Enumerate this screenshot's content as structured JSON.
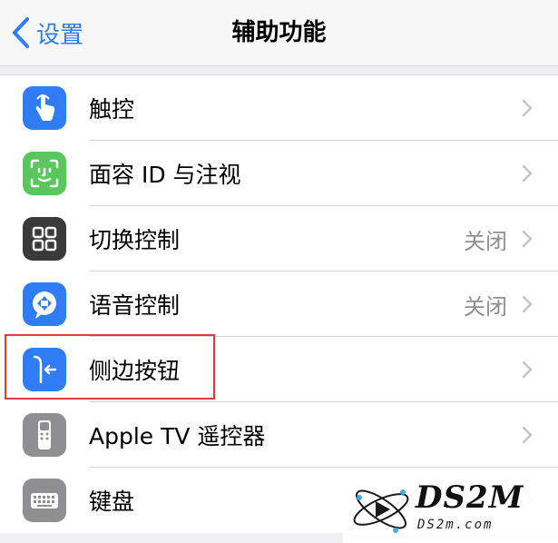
{
  "nav": {
    "back_label": "设置",
    "title": "辅助功能"
  },
  "colors": {
    "accent": "#2f7cf6",
    "highlight": "#e03a3a"
  },
  "rows": [
    {
      "label": "触控",
      "value": "",
      "icon": "hand-touch-icon",
      "icon_color": "#2f7cf6"
    },
    {
      "label": "面容 ID 与注视",
      "value": "",
      "icon": "face-id-icon",
      "icon_color": "#5ac75e"
    },
    {
      "label": "切换控制",
      "value": "关闭",
      "icon": "switch-control-icon",
      "icon_color": "#3a3a3c"
    },
    {
      "label": "语音控制",
      "value": "关闭",
      "icon": "voice-control-icon",
      "icon_color": "#2f7cf6"
    },
    {
      "label": "侧边按钮",
      "value": "",
      "icon": "side-button-icon",
      "icon_color": "#2f7cf6"
    },
    {
      "label": "Apple TV 遥控器",
      "value": "",
      "icon": "remote-icon",
      "icon_color": "#8e8e93"
    },
    {
      "label": "键盘",
      "value": "",
      "icon": "keyboard-icon",
      "icon_color": "#8e8e93"
    }
  ],
  "watermark": {
    "title": "DS2M",
    "subtitle": "DS2m.com"
  }
}
